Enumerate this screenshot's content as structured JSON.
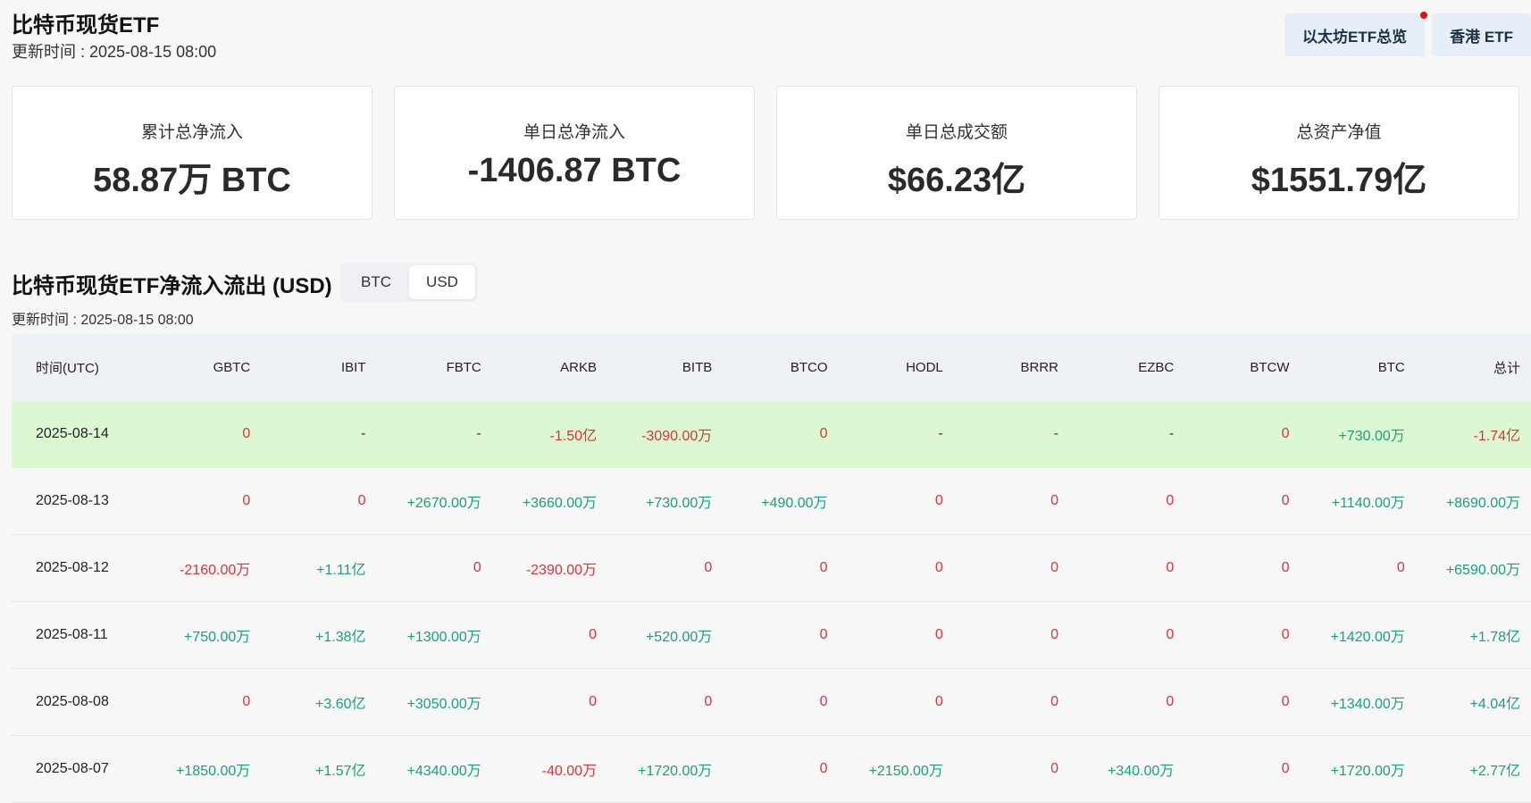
{
  "header": {
    "title": "比特币现货ETF",
    "update_time": "更新时间 : 2025-08-15 08:00",
    "buttons": [
      "以太坊ETF总览",
      "香港 ETF"
    ]
  },
  "cards": [
    {
      "label": "累计总净流入",
      "value": "58.87万 BTC"
    },
    {
      "label": "单日总净流入",
      "value": "-1406.87 BTC"
    },
    {
      "label": "单日总成交额",
      "value": "$66.23亿"
    },
    {
      "label": "总资产净值",
      "value": "$1551.79亿"
    }
  ],
  "section": {
    "title": "比特币现货ETF净流入流出 (USD)",
    "toggle": {
      "options": [
        "BTC",
        "USD"
      ],
      "selected": "USD"
    },
    "update_time": "更新时间 : 2025-08-15 08:00"
  },
  "table": {
    "columns": [
      "时间(UTC)",
      "GBTC",
      "IBIT",
      "FBTC",
      "ARKB",
      "BITB",
      "BTCO",
      "HODL",
      "BRRR",
      "EZBC",
      "BTCW",
      "BTC",
      "总计"
    ],
    "rows": [
      [
        "2025-08-14",
        "0",
        "-",
        "-",
        "-1.50亿",
        "-3090.00万",
        "0",
        "-",
        "-",
        "-",
        "0",
        "+730.00万",
        "-1.74亿"
      ],
      [
        "2025-08-13",
        "0",
        "0",
        "+2670.00万",
        "+3660.00万",
        "+730.00万",
        "+490.00万",
        "0",
        "0",
        "0",
        "0",
        "+1140.00万",
        "+8690.00万"
      ],
      [
        "2025-08-12",
        "-2160.00万",
        "+1.11亿",
        "0",
        "-2390.00万",
        "0",
        "0",
        "0",
        "0",
        "0",
        "0",
        "0",
        "+6590.00万"
      ],
      [
        "2025-08-11",
        "+750.00万",
        "+1.38亿",
        "+1300.00万",
        "0",
        "+520.00万",
        "0",
        "0",
        "0",
        "0",
        "0",
        "+1420.00万",
        "+1.78亿"
      ],
      [
        "2025-08-08",
        "0",
        "+3.60亿",
        "+3050.00万",
        "0",
        "0",
        "0",
        "0",
        "0",
        "0",
        "0",
        "+1340.00万",
        "+4.04亿"
      ],
      [
        "2025-08-07",
        "+1850.00万",
        "+1.57亿",
        "+4340.00万",
        "-40.00万",
        "+1720.00万",
        "0",
        "+2150.00万",
        "0",
        "+340.00万",
        "0",
        "+1720.00万",
        "+2.77亿"
      ]
    ],
    "highlight_row": 0
  },
  "colors": {
    "positive": "#17a37a",
    "negative": "#e0313c",
    "highlight": "#dcf8d3"
  }
}
